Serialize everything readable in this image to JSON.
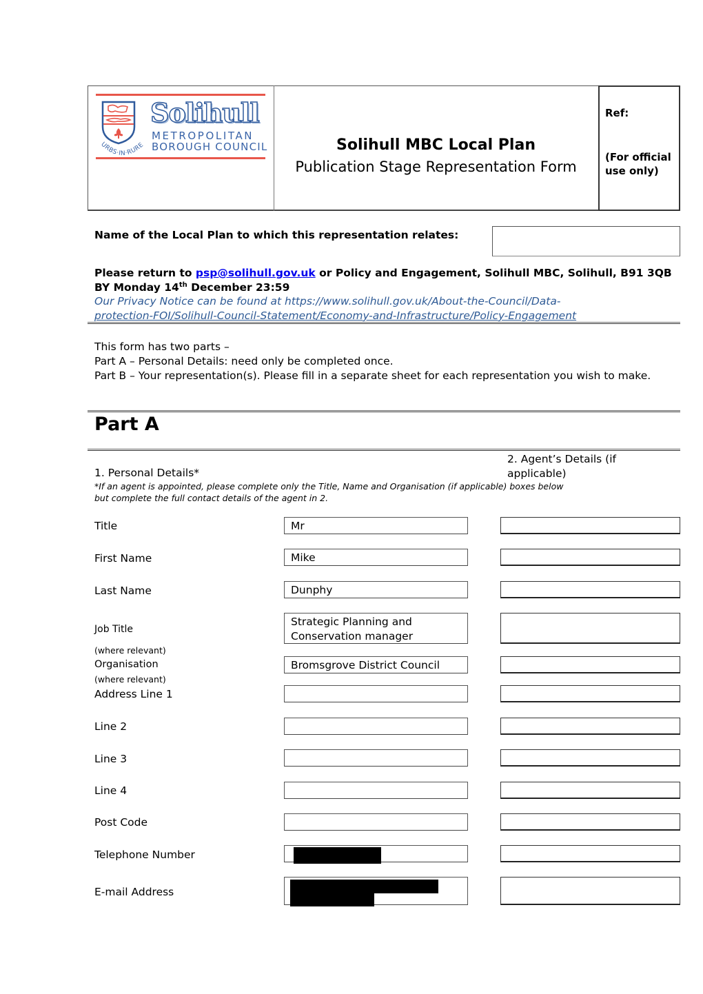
{
  "header": {
    "logo": {
      "wordmark": "Solihull",
      "line1": "METROPOLITAN",
      "line2": "BOROUGH COUNCIL",
      "motto": "URBS·IN·RURE",
      "colors": {
        "red": "#e8564a",
        "blue": "#2f5a9c"
      }
    },
    "title": "Solihull MBC Local Plan",
    "subtitle": "Publication Stage Representation Form",
    "ref_label": "Ref:",
    "official_note": "(For official use only)"
  },
  "local_plan": {
    "label": "Name of the Local Plan to which this representation relates:",
    "value": ""
  },
  "return_info": {
    "prefix": "Please return to ",
    "email": "psp@solihull.gov.uk",
    "middle": " or Policy and Engagement, Solihull MBC, Solihull, B91 3QB BY Monday 14",
    "sup": "th",
    "suffix": " December 23:59",
    "privacy_prefix": "Our Privacy Notice can be found at https://www.solihull.gov.uk/About-the-Council/Data-",
    "privacy_line2": "protection-FOI/Solihull-Council-Statement/Economy-and-Infrastructure/Policy-Engagement",
    "privacy_color": "#2e5a95",
    "link_color": "#0000ee"
  },
  "intro": {
    "line1": "This form has two parts –",
    "line2": "Part A – Personal Details:  need only be completed once.",
    "line3": "Part B – Your representation(s).  Please fill in a separate sheet for each representation you wish to make."
  },
  "part_a": {
    "heading": "Part A",
    "personal_heading": "1. Personal Details*",
    "agent_heading": "2. Agent’s Details (if applicable)",
    "footnote": "*If an agent is appointed, please complete only the Title, Name and Organisation (if applicable) boxes below but complete the full contact details of the agent in 2.",
    "where_relevant": "(where relevant)",
    "fields": [
      {
        "label": "Title",
        "personal": "Mr",
        "agent": ""
      },
      {
        "label": "First Name",
        "personal": "Mike",
        "agent": ""
      },
      {
        "label": "Last Name",
        "personal": "Dunphy",
        "agent": ""
      },
      {
        "label": "Job Title",
        "personal": "Strategic Planning and Conservation manager",
        "agent": ""
      },
      {
        "label": "Organisation",
        "personal": "Bromsgrove District Council",
        "agent": ""
      },
      {
        "label": "Address Line 1",
        "personal": "",
        "agent": ""
      },
      {
        "label": "Line 2",
        "personal": "",
        "agent": ""
      },
      {
        "label": "Line 3",
        "personal": "",
        "agent": ""
      },
      {
        "label": "Line 4",
        "personal": "",
        "agent": ""
      },
      {
        "label": "Post Code",
        "personal": "",
        "agent": ""
      },
      {
        "label": "Telephone Number",
        "personal": "[redacted]",
        "agent": ""
      },
      {
        "label": "E-mail Address",
        "personal": "[redacted]",
        "agent": ""
      }
    ]
  }
}
